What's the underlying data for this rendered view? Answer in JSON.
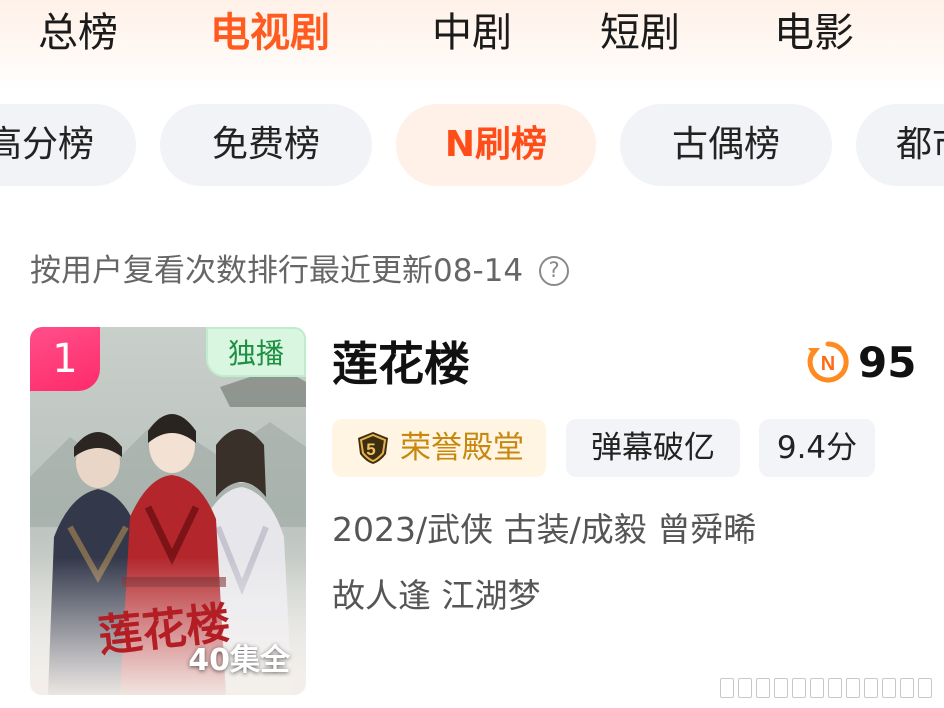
{
  "main_tabs": [
    {
      "label": "总榜",
      "active": false
    },
    {
      "label": "电视剧",
      "active": true
    },
    {
      "label": "中剧",
      "active": false
    },
    {
      "label": "短剧",
      "active": false
    },
    {
      "label": "电影",
      "active": false
    }
  ],
  "sub_tabs": [
    {
      "label": "高分榜",
      "active": false
    },
    {
      "label": "免费榜",
      "active": false
    },
    {
      "label": "N刷榜",
      "active": true
    },
    {
      "label": "古偶榜",
      "active": false
    },
    {
      "label": "都市榜",
      "active": false
    }
  ],
  "subtitle": "按用户复看次数排行最近更新08-14",
  "help_icon": "help-circle-icon",
  "item": {
    "rank": "1",
    "exclusive_label": "独播",
    "episodes": "40集全",
    "poster_calligraphy": "莲花楼",
    "title": "莲花楼",
    "score_icon": "n-refresh-icon",
    "score": "95",
    "tags": {
      "honor": "荣誉殿堂",
      "honor_badge": "5",
      "danmaku": "弹幕破亿",
      "rating": "9.4分"
    },
    "meta_line1": "2023/武侠 古装/成毅 曾舜晞",
    "meta_line2": "故人逢 江湖梦"
  },
  "colors": {
    "accent": "#ff5a1f",
    "rank_badge": "#ff2a6a",
    "exclusive_bg": "#d9f6e1",
    "honor_text": "#c8880f"
  }
}
